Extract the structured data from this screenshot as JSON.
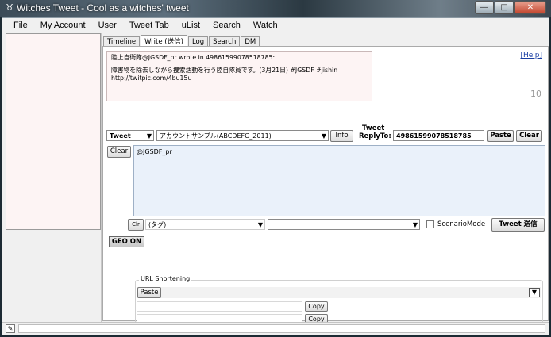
{
  "window": {
    "title": "Witches Tweet - Cool as a witches' tweet",
    "app_icon": "witches-icon",
    "controls": [
      "minimize",
      "maximize",
      "close"
    ]
  },
  "menu": [
    "File",
    "My Account",
    "User",
    "Tweet Tab",
    "uList",
    "Search",
    "Watch"
  ],
  "tabs": [
    {
      "label": "Timeline",
      "active": false
    },
    {
      "label": "Write (送信)",
      "active": true
    },
    {
      "label": "Log",
      "active": false
    },
    {
      "label": "Search",
      "active": false
    },
    {
      "label": "DM",
      "active": false
    }
  ],
  "quote": {
    "header": "陸上自衛隊@JGSDF_pr wrote in 49861599078518785:",
    "body": "障害物を除去しながら捜索活動を行う陸自隊員です。(3月21日) #JGSDF #jishin",
    "link": "http://twitpic.com/4bu15u"
  },
  "help_link": "[Help]",
  "counter": "10",
  "compose": {
    "type_select": "Tweet",
    "account_select": "アカウントサンプル(ABCDEFG_2011)",
    "info_button": "Info",
    "reply_label_line1": "Tweet",
    "reply_label_line2": "ReplyTo:",
    "reply_to_value": "49861599078518785",
    "paste_button": "Paste",
    "clear_button": "Clear",
    "clear_left_button": "Clear",
    "text_value": "@JGSDF_pr"
  },
  "tag_row": {
    "clr_button": "Clr",
    "tag_select": "(タグ)",
    "second_select": "",
    "scenario_label": "ScenarioMode",
    "scenario_checked": false,
    "send_button": "Tweet 送信"
  },
  "geo_button": "GEO ON",
  "url_shortening": {
    "legend": "URL Shortening",
    "paste_button": "Paste",
    "dropdown_icon": "triangle-down-icon",
    "copy_buttons": [
      "Copy",
      "Copy"
    ]
  },
  "statusbar": {
    "icon": "pencil-icon"
  },
  "colors": {
    "quote_bg": "#fdf4f4",
    "editor_bg": "#eaf1fa",
    "help_link": "#1a3fa4"
  }
}
